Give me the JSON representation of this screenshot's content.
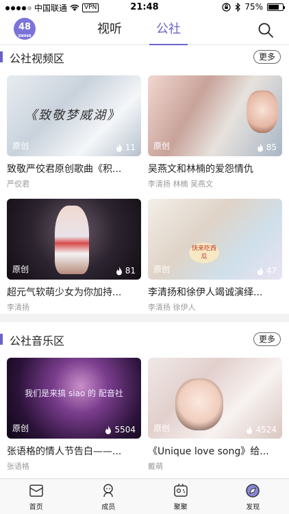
{
  "status_bar": {
    "carrier": "中国联通",
    "vpn": "VPN",
    "time": "21:48",
    "battery": "75%",
    "battery_level": 0.75
  },
  "header": {
    "logo_text": "48",
    "logo_sub": "SNH48",
    "tabs": [
      "视听",
      "公社"
    ],
    "active_tab": "公社"
  },
  "sections": [
    {
      "title": "公社视频区",
      "more": "更多",
      "items": [
        {
          "title": "致敬严佼君原创歌曲《积...",
          "author": "严佼君",
          "tag": "原创",
          "heat": "11",
          "thumb_text": "《致敬梦威湖》"
        },
        {
          "title": "吴燕文和林楠的爱怨情仇",
          "author": "李清扬 林楠 吴燕文",
          "tag": "原创",
          "heat": "85"
        },
        {
          "title": "超元气软萌少女为你加持...",
          "author": "李清扬",
          "tag": "原创",
          "heat": "81"
        },
        {
          "title": "李清扬和徐伊人竭诚演绎...",
          "author": "李清扬 徐伊人",
          "tag": "原创",
          "heat": "47",
          "thumb_text": "快来吃西瓜"
        }
      ]
    },
    {
      "title": "公社音乐区",
      "more": "更多",
      "items": [
        {
          "title": "张语格的情人节告白——...",
          "author": "张语格",
          "tag": "原创",
          "heat": "5504",
          "thumb_text": "我们是来搞 siao 的 配音社"
        },
        {
          "title": "《Unique love song》给...",
          "author": "戴萌",
          "tag": "原创",
          "heat": "4524"
        }
      ]
    }
  ],
  "tab_bar": [
    {
      "label": "首页",
      "icon": "home-icon"
    },
    {
      "label": "成员",
      "icon": "members-icon"
    },
    {
      "label": "聚聚",
      "icon": "gather-icon"
    },
    {
      "label": "发现",
      "icon": "discover-icon"
    }
  ]
}
